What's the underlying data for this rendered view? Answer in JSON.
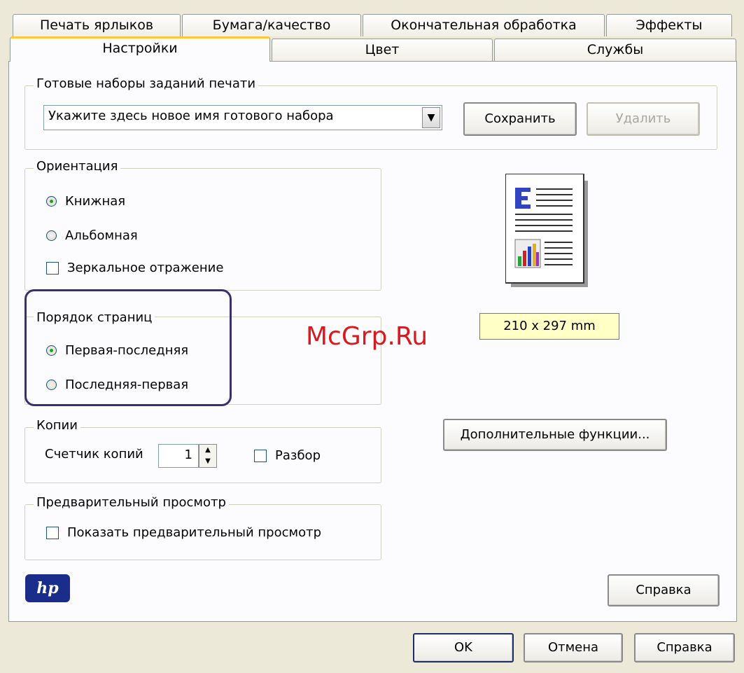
{
  "tabs_back": [
    "Печать ярлыков",
    "Бумага/качество",
    "Окончательная обработка",
    "Эффекты"
  ],
  "tabs_front": [
    "Настройки",
    "Цвет",
    "Службы"
  ],
  "presets": {
    "title": "Готовые наборы заданий печати",
    "value": "Укажите здесь новое имя готового набора",
    "save": "Сохранить",
    "delete": "Удалить"
  },
  "orientation": {
    "title": "Ориентация",
    "portrait": "Книжная",
    "landscape": "Альбомная",
    "mirror": "Зеркальное отражение"
  },
  "page_order": {
    "title": "Порядок страниц",
    "first_last": "Первая-последняя",
    "last_first": "Последняя-первая"
  },
  "copies": {
    "title": "Копии",
    "counter_label": "Счетчик копий",
    "count": "1",
    "collate": "Разбор"
  },
  "preview": {
    "title": "Предварительный просмотр",
    "show": "Показать предварительный просмотр"
  },
  "page_size": "210 x 297 mm",
  "advanced": "Дополнительные функции...",
  "help_inner": "Справка",
  "dialog": {
    "ok": "OK",
    "cancel": "Отмена",
    "help": "Справка"
  },
  "logo": "hp",
  "watermark": "McGrp.Ru"
}
